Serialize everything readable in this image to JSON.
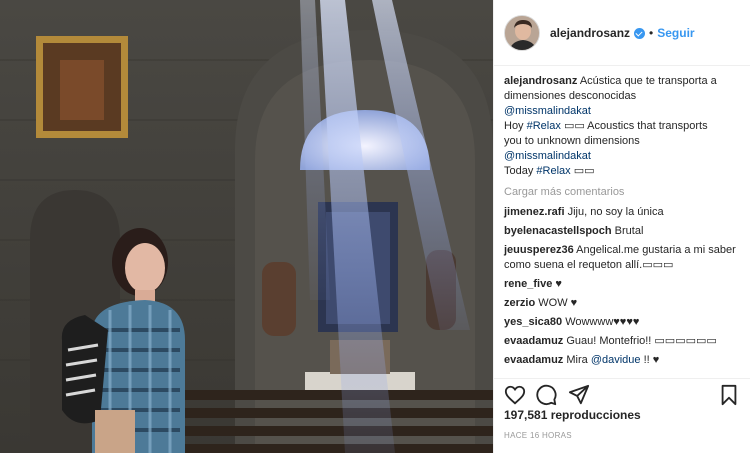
{
  "header": {
    "username": "alejandrosanz",
    "separator": "•",
    "follow_label": "Seguir"
  },
  "caption": {
    "username": "alejandrosanz",
    "line1": "Acústica que te transporta a",
    "line2": "dimensiones desconocidas",
    "mention1": "@missmalindakat",
    "line4_prefix": "Hoy",
    "line4_tag": "#Relax",
    "line4_suffix": "▭▭ Acoustics that transports",
    "line5": "you to unknown dimensions",
    "mention2": "@missmalindakat",
    "line7_prefix": "Today",
    "line7_tag": "#Relax",
    "line7_suffix": "▭▭"
  },
  "load_more": "Cargar más comentarios",
  "comments": [
    {
      "user": "jimenez.rafi",
      "text": "Jiju, no soy la única"
    },
    {
      "user": "byelenacastellspoch",
      "text": "Brutal"
    },
    {
      "user": "jeuusperez36",
      "text": "Angelical.me gustaria a mi saber como suena el requeton allí.▭▭▭"
    },
    {
      "user": "rene_five",
      "text": "♥"
    },
    {
      "user": "zerzio",
      "text": "WOW ♥"
    },
    {
      "user": "yes_sica80",
      "text": "Wowwww♥♥♥♥"
    },
    {
      "user": "evaadamuz",
      "text": "Guau! Montefrio!! ▭▭▭▭▭▭"
    },
    {
      "user": "evaadamuz",
      "text_prefix": "Mira",
      "mention": "@davidue",
      "text_suffix": "!! ♥"
    }
  ],
  "stats": {
    "views": "197,581 reproducciones",
    "time": "HACE 16 HORAS"
  },
  "icons": {
    "like": "heart-outline-icon",
    "comment": "speech-bubble-icon",
    "share": "paper-plane-icon",
    "save": "bookmark-icon",
    "verified": "verified-badge-icon"
  },
  "colors": {
    "link": "#003569",
    "follow": "#3897f0",
    "muted": "#999999",
    "text": "#262626"
  }
}
